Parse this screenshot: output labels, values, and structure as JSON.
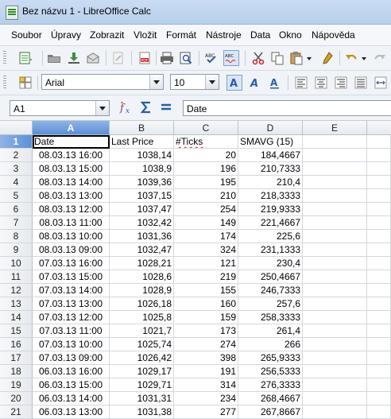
{
  "window": {
    "title": "Bez názvu 1 - LibreOffice Calc"
  },
  "menu": [
    "Soubor",
    "Úpravy",
    "Zobrazit",
    "Vložit",
    "Formát",
    "Nástroje",
    "Data",
    "Okno",
    "Nápověda"
  ],
  "font": {
    "name": "Arial",
    "size": "10"
  },
  "formula": {
    "cell_ref": "A1",
    "content": "Date"
  },
  "columns": [
    "A",
    "B",
    "C",
    "D",
    "E"
  ],
  "rows": [
    {
      "n": "1",
      "a": "Date",
      "b": "Last Price",
      "c": "#Ticks",
      "d": "SMAVG (15)"
    },
    {
      "n": "2",
      "a": "08.03.13 16:00",
      "b": "1038,14",
      "c": "20",
      "d": "184,4667"
    },
    {
      "n": "3",
      "a": "08.03.13 15:00",
      "b": "1038,9",
      "c": "196",
      "d": "210,7333"
    },
    {
      "n": "4",
      "a": "08.03.13 14:00",
      "b": "1039,36",
      "c": "195",
      "d": "210,4"
    },
    {
      "n": "5",
      "a": "08.03.13 13:00",
      "b": "1037,15",
      "c": "210",
      "d": "218,3333"
    },
    {
      "n": "6",
      "a": "08.03.13 12:00",
      "b": "1037,47",
      "c": "254",
      "d": "219,9333"
    },
    {
      "n": "7",
      "a": "08.03.13 11:00",
      "b": "1032,42",
      "c": "149",
      "d": "221,4667"
    },
    {
      "n": "8",
      "a": "08.03.13 10:00",
      "b": "1031,36",
      "c": "174",
      "d": "225,6"
    },
    {
      "n": "9",
      "a": "08.03.13 09:00",
      "b": "1032,47",
      "c": "324",
      "d": "231,1333"
    },
    {
      "n": "10",
      "a": "07.03.13 16:00",
      "b": "1028,21",
      "c": "121",
      "d": "230,4"
    },
    {
      "n": "11",
      "a": "07.03.13 15:00",
      "b": "1028,6",
      "c": "219",
      "d": "250,4667"
    },
    {
      "n": "12",
      "a": "07.03.13 14:00",
      "b": "1028,9",
      "c": "155",
      "d": "246,7333"
    },
    {
      "n": "13",
      "a": "07.03.13 13:00",
      "b": "1026,18",
      "c": "160",
      "d": "257,6"
    },
    {
      "n": "14",
      "a": "07.03.13 12:00",
      "b": "1025,8",
      "c": "159",
      "d": "258,3333"
    },
    {
      "n": "15",
      "a": "07.03.13 11:00",
      "b": "1021,7",
      "c": "173",
      "d": "261,4"
    },
    {
      "n": "16",
      "a": "07.03.13 10:00",
      "b": "1025,74",
      "c": "274",
      "d": "266"
    },
    {
      "n": "17",
      "a": "07.03.13 09:00",
      "b": "1026,42",
      "c": "398",
      "d": "265,9333"
    },
    {
      "n": "18",
      "a": "06.03.13 16:00",
      "b": "1029,17",
      "c": "191",
      "d": "256,5333"
    },
    {
      "n": "19",
      "a": "06.03.13 15:00",
      "b": "1029,71",
      "c": "314",
      "d": "276,3333"
    },
    {
      "n": "20",
      "a": "06.03.13 14:00",
      "b": "1031,31",
      "c": "234",
      "d": "268,4667"
    },
    {
      "n": "21",
      "a": "06.03.13 13:00",
      "b": "1031,38",
      "c": "277",
      "d": "267,8667"
    }
  ]
}
